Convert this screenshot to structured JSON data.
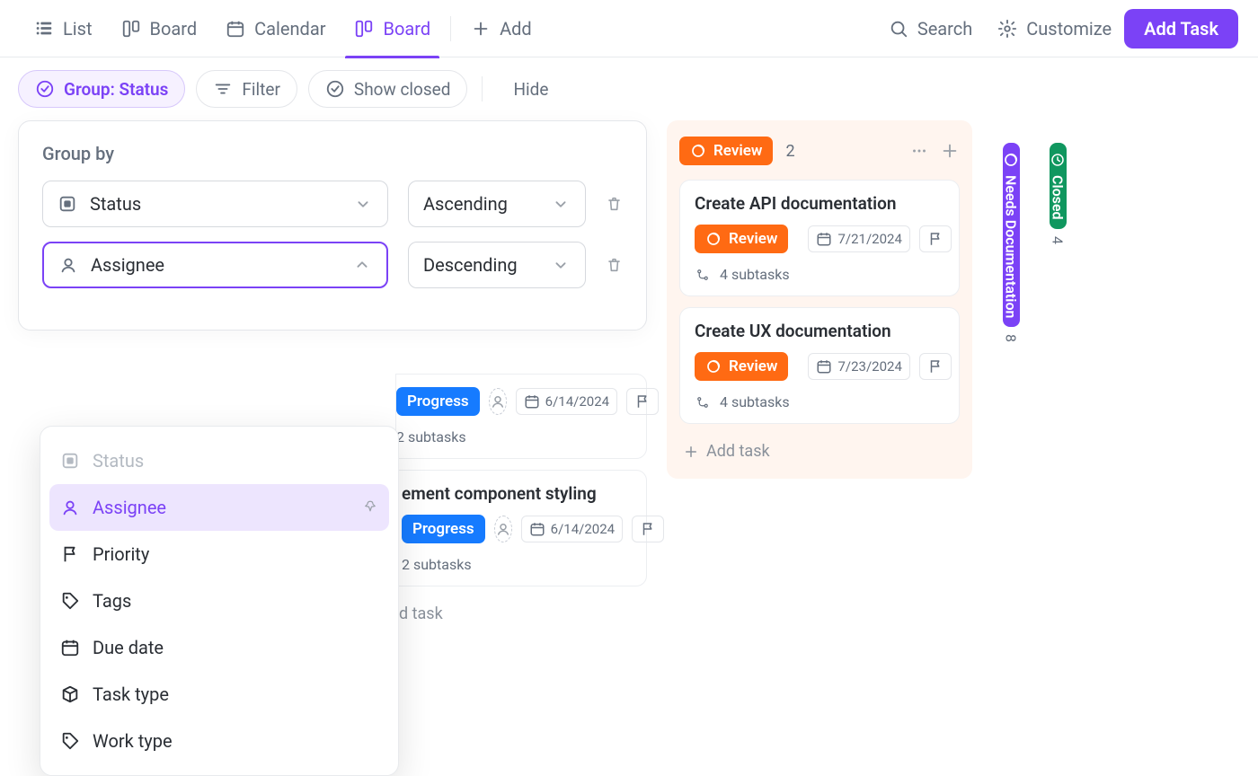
{
  "viewbar": {
    "tabs": [
      {
        "label": "List",
        "icon": "list"
      },
      {
        "label": "Board",
        "icon": "board"
      },
      {
        "label": "Calendar",
        "icon": "calendar"
      },
      {
        "label": "Board",
        "icon": "board",
        "active": true
      }
    ],
    "add_label": "Add",
    "search_label": "Search",
    "customize_label": "Customize",
    "addtask_label": "Add Task"
  },
  "toolbar": {
    "group_label": "Group: Status",
    "filter_label": "Filter",
    "show_closed_label": "Show closed",
    "hide_label": "Hide"
  },
  "groupby": {
    "heading": "Group by",
    "rows": [
      {
        "field": "Status",
        "sort": "Ascending",
        "focused": false
      },
      {
        "field": "Assignee",
        "sort": "Descending",
        "focused": true
      }
    ],
    "options": [
      {
        "label": "Status",
        "icon": "status",
        "state": "disabled"
      },
      {
        "label": "Assignee",
        "icon": "user",
        "state": "selected"
      },
      {
        "label": "Priority",
        "icon": "flag",
        "state": "normal"
      },
      {
        "label": "Tags",
        "icon": "tag",
        "state": "normal"
      },
      {
        "label": "Due date",
        "icon": "calendar",
        "state": "normal"
      },
      {
        "label": "Task type",
        "icon": "box",
        "state": "normal"
      },
      {
        "label": "Work type",
        "icon": "tag",
        "state": "normal"
      }
    ]
  },
  "columns": {
    "in_progress": {
      "status_label": "Progress",
      "cards": [
        {
          "title_fragment": "ement component styling",
          "date": "6/14/2024",
          "subtasks_text": "2 subtasks"
        }
      ],
      "hidden_date_fragment": "6/14/2024",
      "hidden_subtasks_fragment": "2 subtasks",
      "add_task_fragment": "d task"
    },
    "review": {
      "status_label": "Review",
      "count": "2",
      "cards": [
        {
          "title": "Create API documentation",
          "date": "7/21/2024",
          "subtasks_text": "4 subtasks"
        },
        {
          "title": "Create UX documentation",
          "date": "7/23/2024",
          "subtasks_text": "4 subtasks"
        }
      ],
      "add_task_label": "Add task"
    },
    "collapsed": [
      {
        "label": "Needs Documentation",
        "count": "8",
        "color": "nd"
      },
      {
        "label": "Closed",
        "count": "4",
        "color": "cl"
      }
    ]
  }
}
